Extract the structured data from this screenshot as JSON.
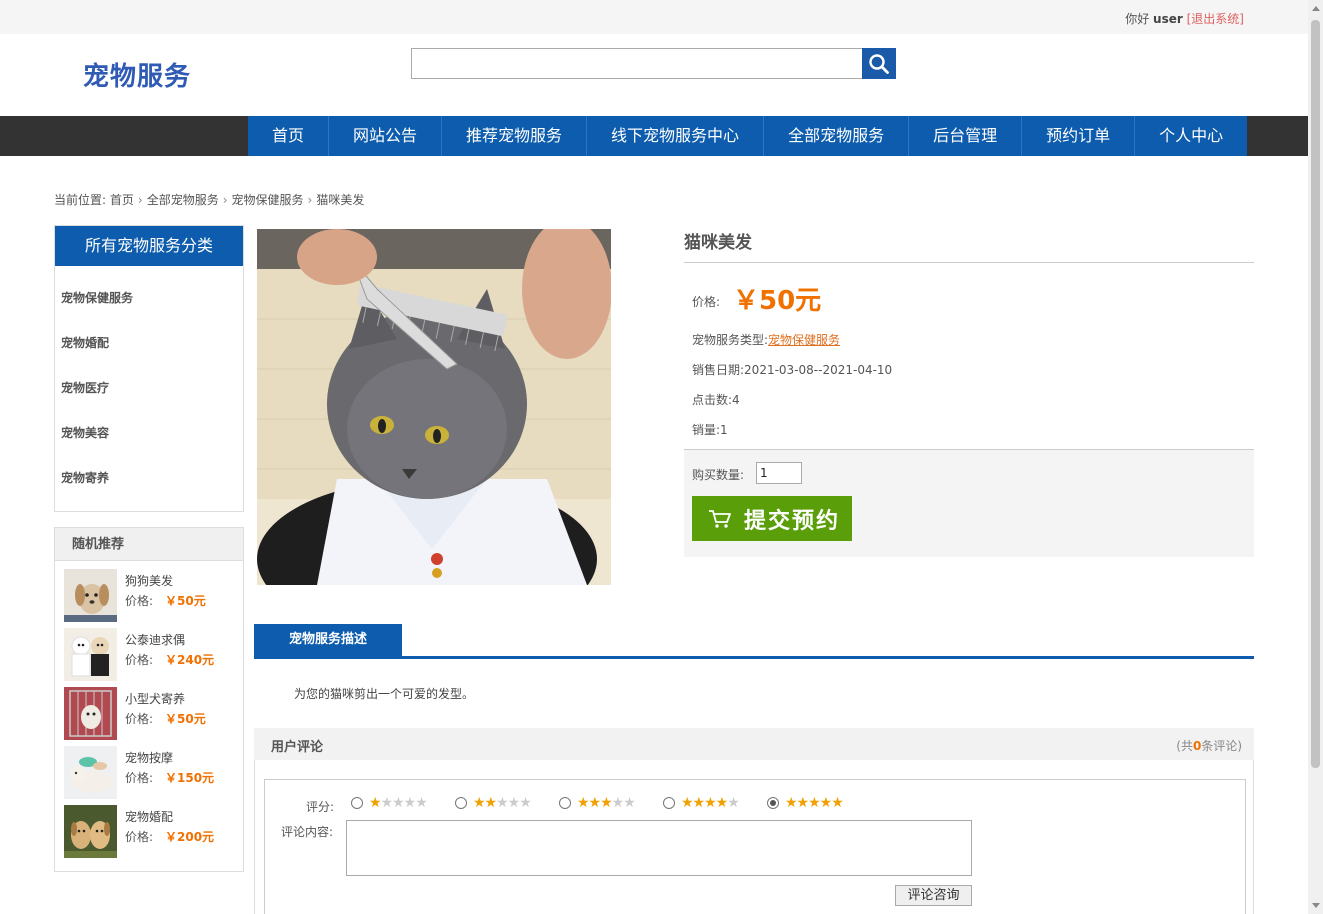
{
  "topbar": {
    "greeting": "你好",
    "username": "user",
    "logout": "[退出系统]"
  },
  "header": {
    "logo": "宠物服务",
    "search": {
      "value": "",
      "placeholder": ""
    },
    "search_icon": "search-icon"
  },
  "nav": [
    {
      "label": "首页"
    },
    {
      "label": "网站公告"
    },
    {
      "label": "推荐宠物服务"
    },
    {
      "label": "线下宠物服务中心"
    },
    {
      "label": "全部宠物服务"
    },
    {
      "label": "后台管理"
    },
    {
      "label": "预约订单"
    },
    {
      "label": "个人中心"
    }
  ],
  "breadcrumb": {
    "prefix": "当前位置:",
    "items": [
      "首页",
      "全部宠物服务",
      "宠物保健服务",
      "猫咪美发"
    ]
  },
  "sidebar": {
    "category_title": "所有宠物服务分类",
    "categories": [
      "宠物保健服务",
      "宠物婚配",
      "宠物医疗",
      "宠物美容",
      "宠物寄养"
    ],
    "random_title": "随机推荐",
    "price_label": "价格:",
    "random": [
      {
        "name": "狗狗美发",
        "price": "￥50元"
      },
      {
        "name": "公泰迪求偶",
        "price": "￥240元"
      },
      {
        "name": "小型犬寄养",
        "price": "￥50元"
      },
      {
        "name": "宠物按摩",
        "price": "￥150元"
      },
      {
        "name": "宠物婚配",
        "price": "￥200元"
      }
    ]
  },
  "product": {
    "title": "猫咪美发",
    "price_label": "价格:",
    "price": "￥50元",
    "type_label": "宠物服务类型:",
    "type_value": "宠物保健服务",
    "date_label": "销售日期:",
    "date_value": "2021-03-08--2021-04-10",
    "clicks_label": "点击数:",
    "clicks_value": "4",
    "sales_label": "销量:",
    "sales_value": "1",
    "qty_label": "购买数量:",
    "qty_value": "1",
    "submit_label": "提交预约"
  },
  "description": {
    "tab": "宠物服务描述",
    "text": "为您的猫咪剪出一个可爱的发型。"
  },
  "comments": {
    "title": "用户评论",
    "count_prefix": "(共",
    "count": "0",
    "count_suffix": "条评论)",
    "rating_label": "评分:",
    "selected_rating": 5,
    "content_label": "评论内容:",
    "textarea_value": "",
    "submit_label": "评论咨询"
  },
  "colors": {
    "brand_blue": "#0d5cad",
    "price_orange": "#f07000",
    "submit_green": "#5a9e0a",
    "logout_red": "#e06060"
  }
}
